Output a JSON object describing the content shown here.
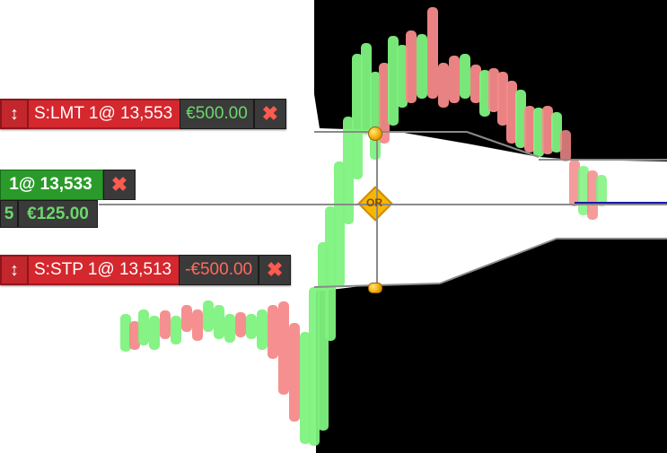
{
  "orders": {
    "limit": {
      "drag_icon": "↕",
      "label": "S:LMT 1@ 13,553",
      "pnl": "€500.00",
      "close_icon": "✖"
    },
    "position": {
      "label": "1@ 13,533",
      "close_icon": "✖",
      "qty": "5",
      "pnl": "€125.00"
    },
    "stop": {
      "drag_icon": "↕",
      "label": "S:STP 1@ 13,513",
      "pnl": "-€500.00",
      "close_icon": "✖"
    }
  },
  "or_badge": {
    "label": "OR"
  },
  "colors": {
    "up_candle": "#7ef27e",
    "down_candle": "#f58a8a",
    "order_red": "#d4272e",
    "position_green": "#2a9b2a",
    "panel_dark": "#3a3a3a",
    "chart_background": "#000000",
    "price_line": "#8a8a8a",
    "or_badge": "#f5b800"
  }
}
